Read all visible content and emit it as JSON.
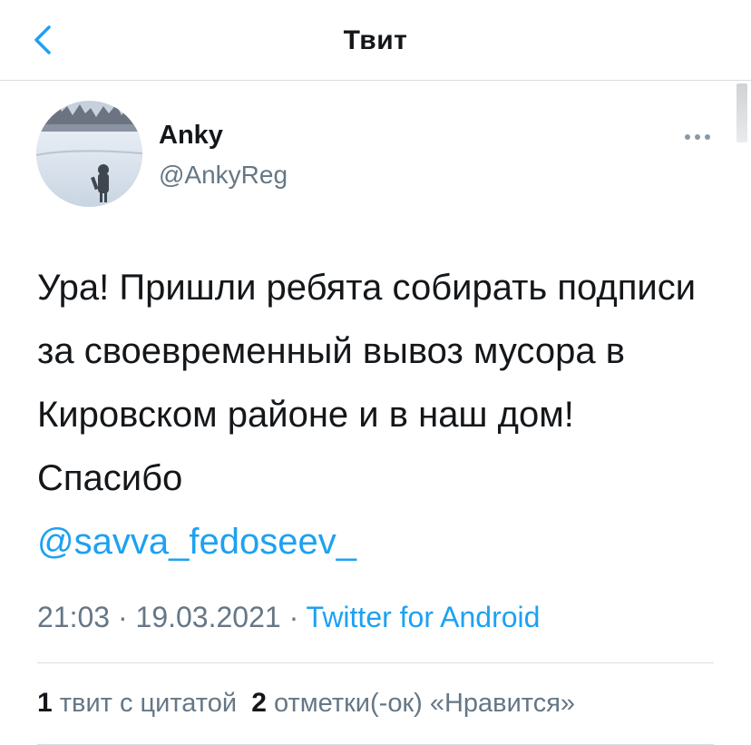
{
  "header": {
    "title": "Твит",
    "back_icon": "chevron-left-icon",
    "accent_color": "#1da1f2"
  },
  "tweet": {
    "author": {
      "display_name": "Anky",
      "username": "@AnkyReg"
    },
    "text": "Ура! Пришли ребята собирать подписи за своевременный вывоз мусора в Кировском районе и в наш дом! Спасибо",
    "mention": "@savva_fedoseev_",
    "time": "21:03",
    "separator": "·",
    "date": "19.03.2021",
    "source": "Twitter for Android",
    "stats": {
      "quote_count": "1",
      "quote_label": "твит с цитатой",
      "like_count": "2",
      "like_label": "отметки(-ок) «Нравится»"
    }
  }
}
